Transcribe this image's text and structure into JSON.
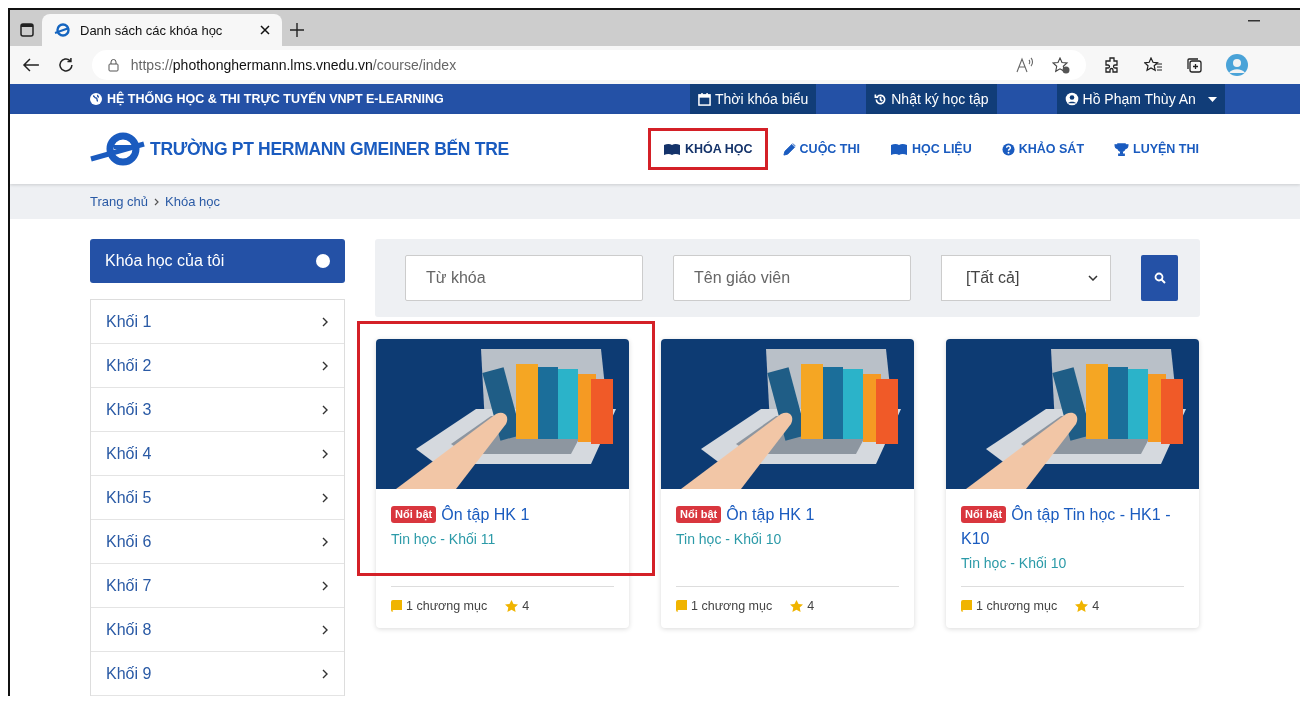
{
  "browser": {
    "tab_title": "Danh sách các khóa học",
    "url_scheme": "https://",
    "url_host": "phothonghermann.lms.vnedu.vn",
    "url_path": "/course/index"
  },
  "topbar": {
    "system_title": "HỆ THỐNG HỌC & THI TRỰC TUYẾN VNPT E-LEARNING",
    "links": [
      {
        "label": "Thời khóa biểu",
        "kind": "calendar"
      },
      {
        "label": "Nhật ký học tập",
        "kind": "history"
      },
      {
        "label": "Hồ Phạm Thùy An",
        "kind": "user"
      }
    ]
  },
  "header": {
    "school_name": "TRƯỜNG PT HERMANN GMEINER BẾN TRE",
    "nav": [
      {
        "label": "KHÓA HỌC",
        "selected": true,
        "highlighted": true
      },
      {
        "label": "CUỘC THI",
        "selected": false,
        "highlighted": false
      },
      {
        "label": "HỌC LIỆU",
        "selected": false,
        "highlighted": false
      },
      {
        "label": "KHẢO SÁT",
        "selected": false,
        "highlighted": false
      },
      {
        "label": "LUYỆN THI",
        "selected": false,
        "highlighted": false
      }
    ]
  },
  "breadcrumb": [
    "Trang chủ",
    "Khóa học"
  ],
  "sidebar": {
    "title": "Khóa học của tôi",
    "items": [
      "Khối 1",
      "Khối 2",
      "Khối 3",
      "Khối 4",
      "Khối 5",
      "Khối 6",
      "Khối 7",
      "Khối 8",
      "Khối 9"
    ]
  },
  "search": {
    "keyword_placeholder": "Từ khóa",
    "teacher_placeholder": "Tên giáo viên",
    "category_value": "[Tất cả]"
  },
  "courses": [
    {
      "badge": "Nổi bật",
      "title": "Ôn tập HK 1",
      "subtitle": "Tin học - Khối 11",
      "chapters": "1 chương mục",
      "rating": "4",
      "highlighted": true
    },
    {
      "badge": "Nổi bật",
      "title": "Ôn tập HK 1",
      "subtitle": "Tin học - Khối 10",
      "chapters": "1 chương mục",
      "rating": "4",
      "highlighted": false
    },
    {
      "badge": "Nổi bật",
      "title": "Ôn tập Tin học - HK1 - K10",
      "subtitle": "Tin học - Khối 10",
      "chapters": "1 chương mục",
      "rating": "4",
      "highlighted": false
    }
  ]
}
